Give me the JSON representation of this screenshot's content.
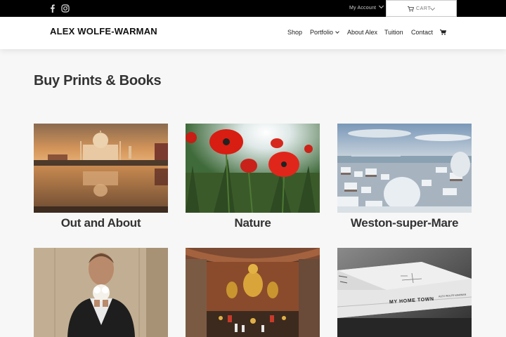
{
  "topbar": {
    "social": [
      "facebook-icon",
      "instagram-icon"
    ],
    "account_label": "My Account",
    "cart_label": "CART"
  },
  "header": {
    "logo": "ALEX WOLFE-WARMAN",
    "nav": [
      {
        "label": "Shop"
      },
      {
        "label": "Portfolio"
      },
      {
        "label": "About Alex"
      },
      {
        "label": "Tuition"
      },
      {
        "label": "Contact"
      }
    ],
    "cart_icon": "shopping-cart-icon"
  },
  "page": {
    "title": "Buy Prints & Books",
    "categories": [
      {
        "title": "Out and About"
      },
      {
        "title": "Nature"
      },
      {
        "title": "Weston-super-Mare"
      },
      {
        "title": ""
      },
      {
        "title": ""
      },
      {
        "title": ""
      }
    ],
    "book_text": "MY HOME TOWN",
    "book_author": "ALEX WOLFE-WARMAN"
  },
  "colors": {
    "topbar": "#000000",
    "header": "#ffffff",
    "page_bg": "#f7f7f7",
    "heading": "#333333"
  }
}
